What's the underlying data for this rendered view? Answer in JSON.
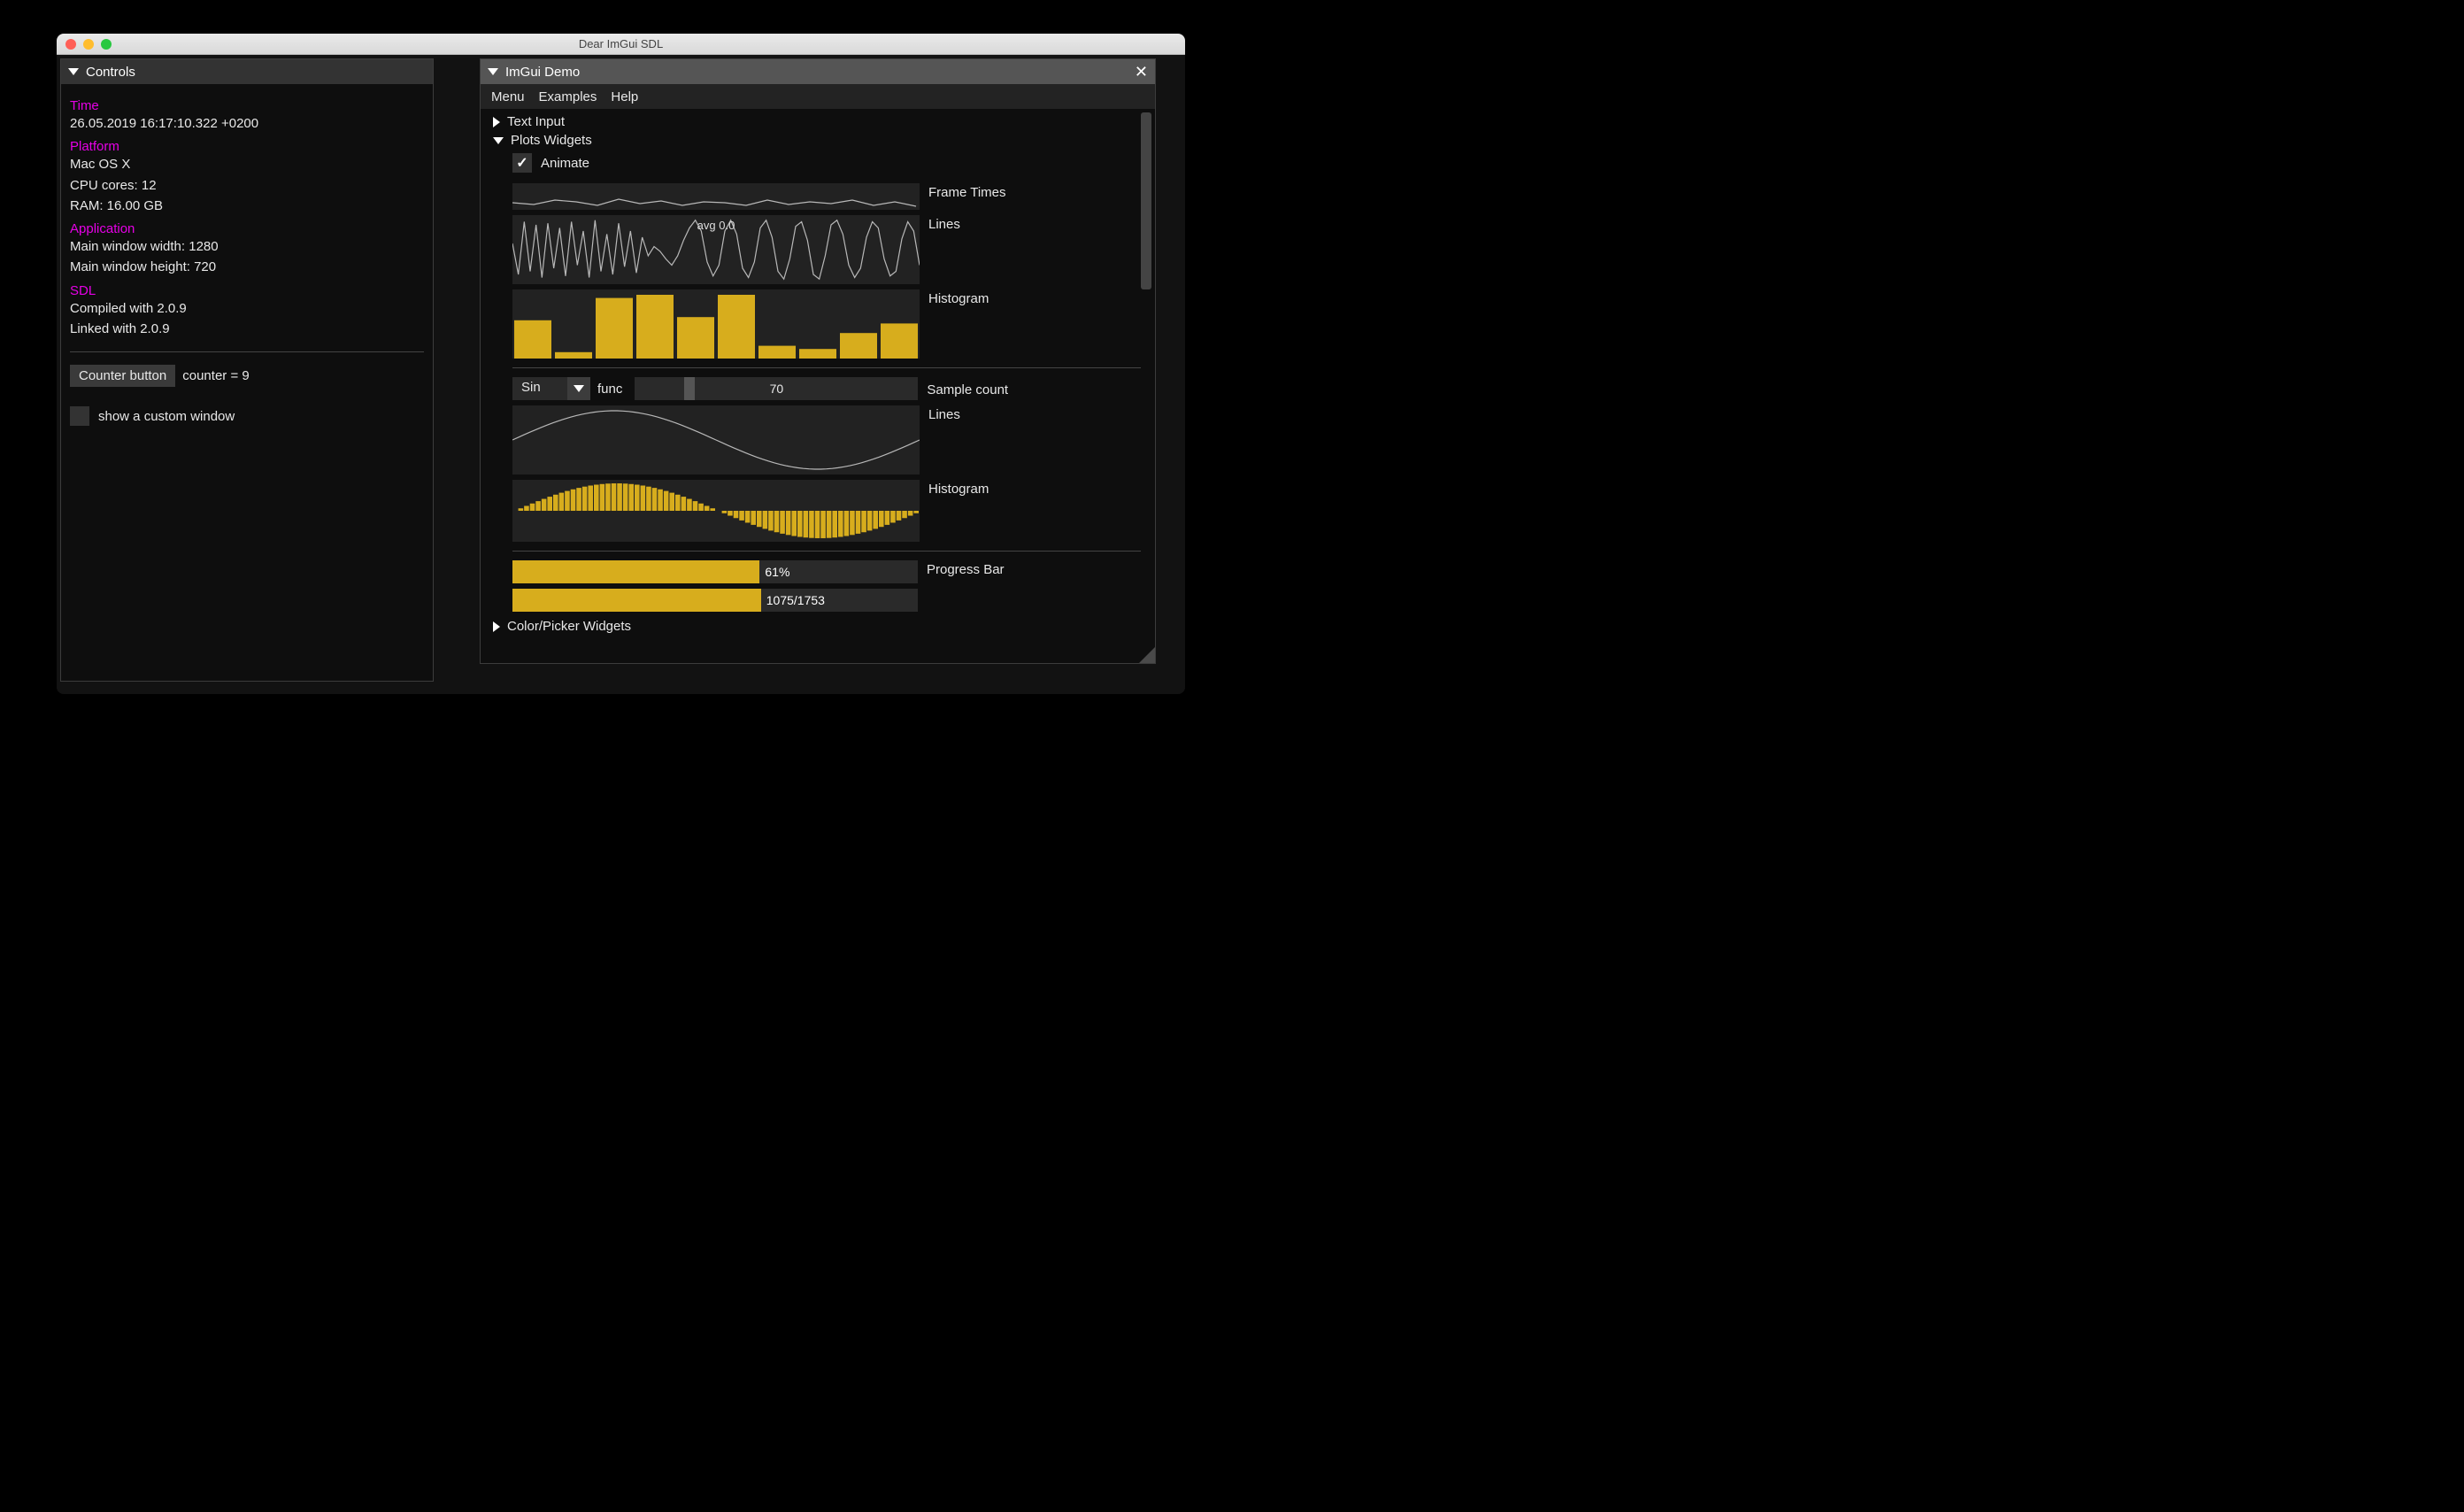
{
  "window": {
    "title": "Dear ImGui SDL"
  },
  "controls": {
    "title": "Controls",
    "time_heading": "Time",
    "time_value": "26.05.2019 16:17:10.322 +0200",
    "platform_heading": "Platform",
    "platform_os": "Mac OS X",
    "cpu": "CPU cores: 12",
    "ram": "RAM: 16.00 GB",
    "app_heading": "Application",
    "win_w": "Main window width: 1280",
    "win_h": "Main window height: 720",
    "sdl_heading": "SDL",
    "sdl_compiled": "Compiled with 2.0.9",
    "sdl_linked": "Linked with 2.0.9",
    "counter_btn": "Counter button",
    "counter_txt": "counter = 9",
    "custom_chk": "show a custom window"
  },
  "demo": {
    "title": "ImGui Demo",
    "menu": {
      "m1": "Menu",
      "m2": "Examples",
      "m3": "Help"
    },
    "tree": {
      "text_input": "Text Input",
      "plots": "Plots Widgets",
      "color_picker": "Color/Picker Widgets"
    },
    "animate": "Animate",
    "labels": {
      "frame_times": "Frame Times",
      "lines": "Lines",
      "histogram": "Histogram",
      "lines2": "Lines",
      "histogram2": "Histogram",
      "sample_count": "Sample count",
      "progress": "Progress Bar"
    },
    "avg_text": "avg 0.0",
    "func_combo": "Sin",
    "func_label": "func",
    "sample_value": "70",
    "progress1_pct": "61%",
    "progress2_txt": "1075/1753"
  },
  "chart_data": [
    {
      "type": "line",
      "name": "Frame Times",
      "values": [
        0.07,
        0.05,
        0.12,
        0.08,
        0.03,
        0.14,
        0.06,
        0.1,
        0.04,
        0.09,
        0.07,
        0.03,
        0.11,
        0.05,
        0.08,
        0.06,
        0.12,
        0.04,
        0.09,
        0.02
      ],
      "ylim": [
        0,
        1
      ]
    },
    {
      "type": "line",
      "name": "Lines (avg 0.0)",
      "x": [
        0,
        1,
        2,
        3,
        4,
        5,
        6,
        7,
        8,
        9,
        10,
        11,
        12,
        13,
        14,
        15,
        16,
        17,
        18,
        19,
        20,
        21,
        22,
        23,
        24,
        25,
        26,
        27,
        28,
        29,
        30,
        31,
        32,
        33,
        34,
        35,
        36,
        37,
        38,
        39,
        40,
        41,
        42,
        43,
        44,
        45,
        46,
        47,
        48,
        49,
        50,
        51,
        52,
        53,
        54,
        55,
        56,
        57,
        58,
        59,
        60,
        61,
        62,
        63,
        64,
        65,
        66,
        67,
        68,
        69
      ],
      "values": [
        0.2,
        -0.8,
        0.9,
        -0.7,
        0.8,
        -0.9,
        0.85,
        -0.6,
        0.7,
        -0.85,
        0.9,
        -0.5,
        0.6,
        -0.9,
        0.95,
        -0.7,
        0.5,
        -0.8,
        0.85,
        -0.55,
        0.6,
        -0.75,
        0.4,
        -0.2,
        0.1,
        -0.05,
        -0.3,
        -0.5,
        -0.2,
        0.3,
        0.7,
        0.95,
        0.6,
        -0.4,
        -0.85,
        -0.5,
        0.6,
        0.95,
        0.5,
        -0.6,
        -0.9,
        -0.4,
        0.7,
        0.95,
        0.4,
        -0.7,
        -0.95,
        -0.3,
        0.75,
        0.9,
        0.3,
        -0.8,
        -0.95,
        -0.2,
        0.8,
        0.95,
        0.5,
        -0.5,
        -0.9,
        -0.6,
        0.4,
        0.9,
        0.7,
        -0.3,
        -0.85,
        -0.7,
        0.35,
        0.9,
        0.6,
        -0.5
      ],
      "ylim": [
        -1,
        1
      ]
    },
    {
      "type": "bar",
      "name": "Histogram",
      "categories": [
        "0",
        "1",
        "2",
        "3",
        "4",
        "5",
        "6",
        "7",
        "8",
        "9"
      ],
      "values": [
        0.6,
        0.1,
        0.95,
        1.0,
        0.65,
        1.0,
        0.2,
        0.15,
        0.4,
        0.55
      ],
      "ylim": [
        0,
        1
      ]
    },
    {
      "type": "line",
      "name": "Lines (Sin)",
      "x_range": [
        0,
        70
      ],
      "values_fn": "sin(2*pi*x/70)",
      "ylim": [
        -1,
        1
      ]
    },
    {
      "type": "bar",
      "name": "Histogram (Sin)",
      "x_range": [
        0,
        70
      ],
      "values_fn": "sin(2*pi*x/70)",
      "ylim": [
        -1,
        1
      ]
    }
  ],
  "colors": {
    "accent": "#d7ad1d",
    "heading": "#e600e6"
  }
}
